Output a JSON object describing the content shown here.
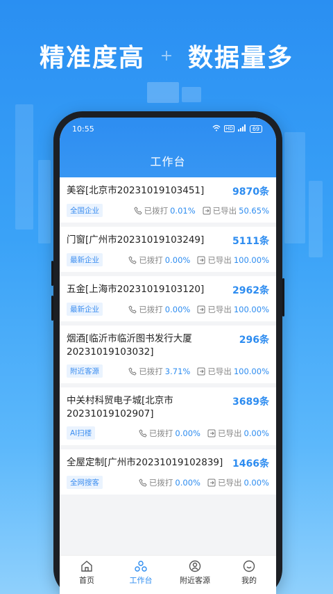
{
  "promo": {
    "left": "精准度高",
    "right": "数据量多"
  },
  "status": {
    "time": "10:55",
    "battery": "69"
  },
  "header": {
    "title": "工作台"
  },
  "items": [
    {
      "name": "美容[北京市20231019103451]",
      "count": "9870条",
      "tag": "全国企业",
      "dialed_label": "已拨打",
      "dialed": "0.01%",
      "exported_label": "已导出",
      "exported": "50.65%"
    },
    {
      "name": "门窗[广州市20231019103249]",
      "count": "5111条",
      "tag": "最新企业",
      "dialed_label": "已拨打",
      "dialed": "0.00%",
      "exported_label": "已导出",
      "exported": "100.00%"
    },
    {
      "name": "五金[上海市20231019103120]",
      "count": "2962条",
      "tag": "最新企业",
      "dialed_label": "已拨打",
      "dialed": "0.00%",
      "exported_label": "已导出",
      "exported": "100.00%"
    },
    {
      "name": "烟酒[临沂市临沂图书发行大厦20231019103032]",
      "count": "296条",
      "tag": "附近客源",
      "dialed_label": "已拨打",
      "dialed": "3.71%",
      "exported_label": "已导出",
      "exported": "100.00%"
    },
    {
      "name": "中关村科贸电子城[北京市20231019102907]",
      "count": "3689条",
      "tag": "AI扫楼",
      "dialed_label": "已拨打",
      "dialed": "0.00%",
      "exported_label": "已导出",
      "exported": "0.00%"
    },
    {
      "name": "全屋定制[广州市20231019102839]",
      "count": "1466条",
      "tag": "全网搜客",
      "dialed_label": "已拨打",
      "dialed": "0.00%",
      "exported_label": "已导出",
      "exported": "0.00%"
    }
  ],
  "tabs": [
    {
      "label": "首页",
      "icon": "home-icon",
      "active": false
    },
    {
      "label": "工作台",
      "icon": "workbench-icon",
      "active": true
    },
    {
      "label": "附近客源",
      "icon": "nearby-icon",
      "active": false
    },
    {
      "label": "我的",
      "icon": "profile-icon",
      "active": false
    }
  ],
  "colors": {
    "accent": "#2d8cf0",
    "header": "#2d8df1",
    "tag_bg": "#eaf3fe"
  }
}
